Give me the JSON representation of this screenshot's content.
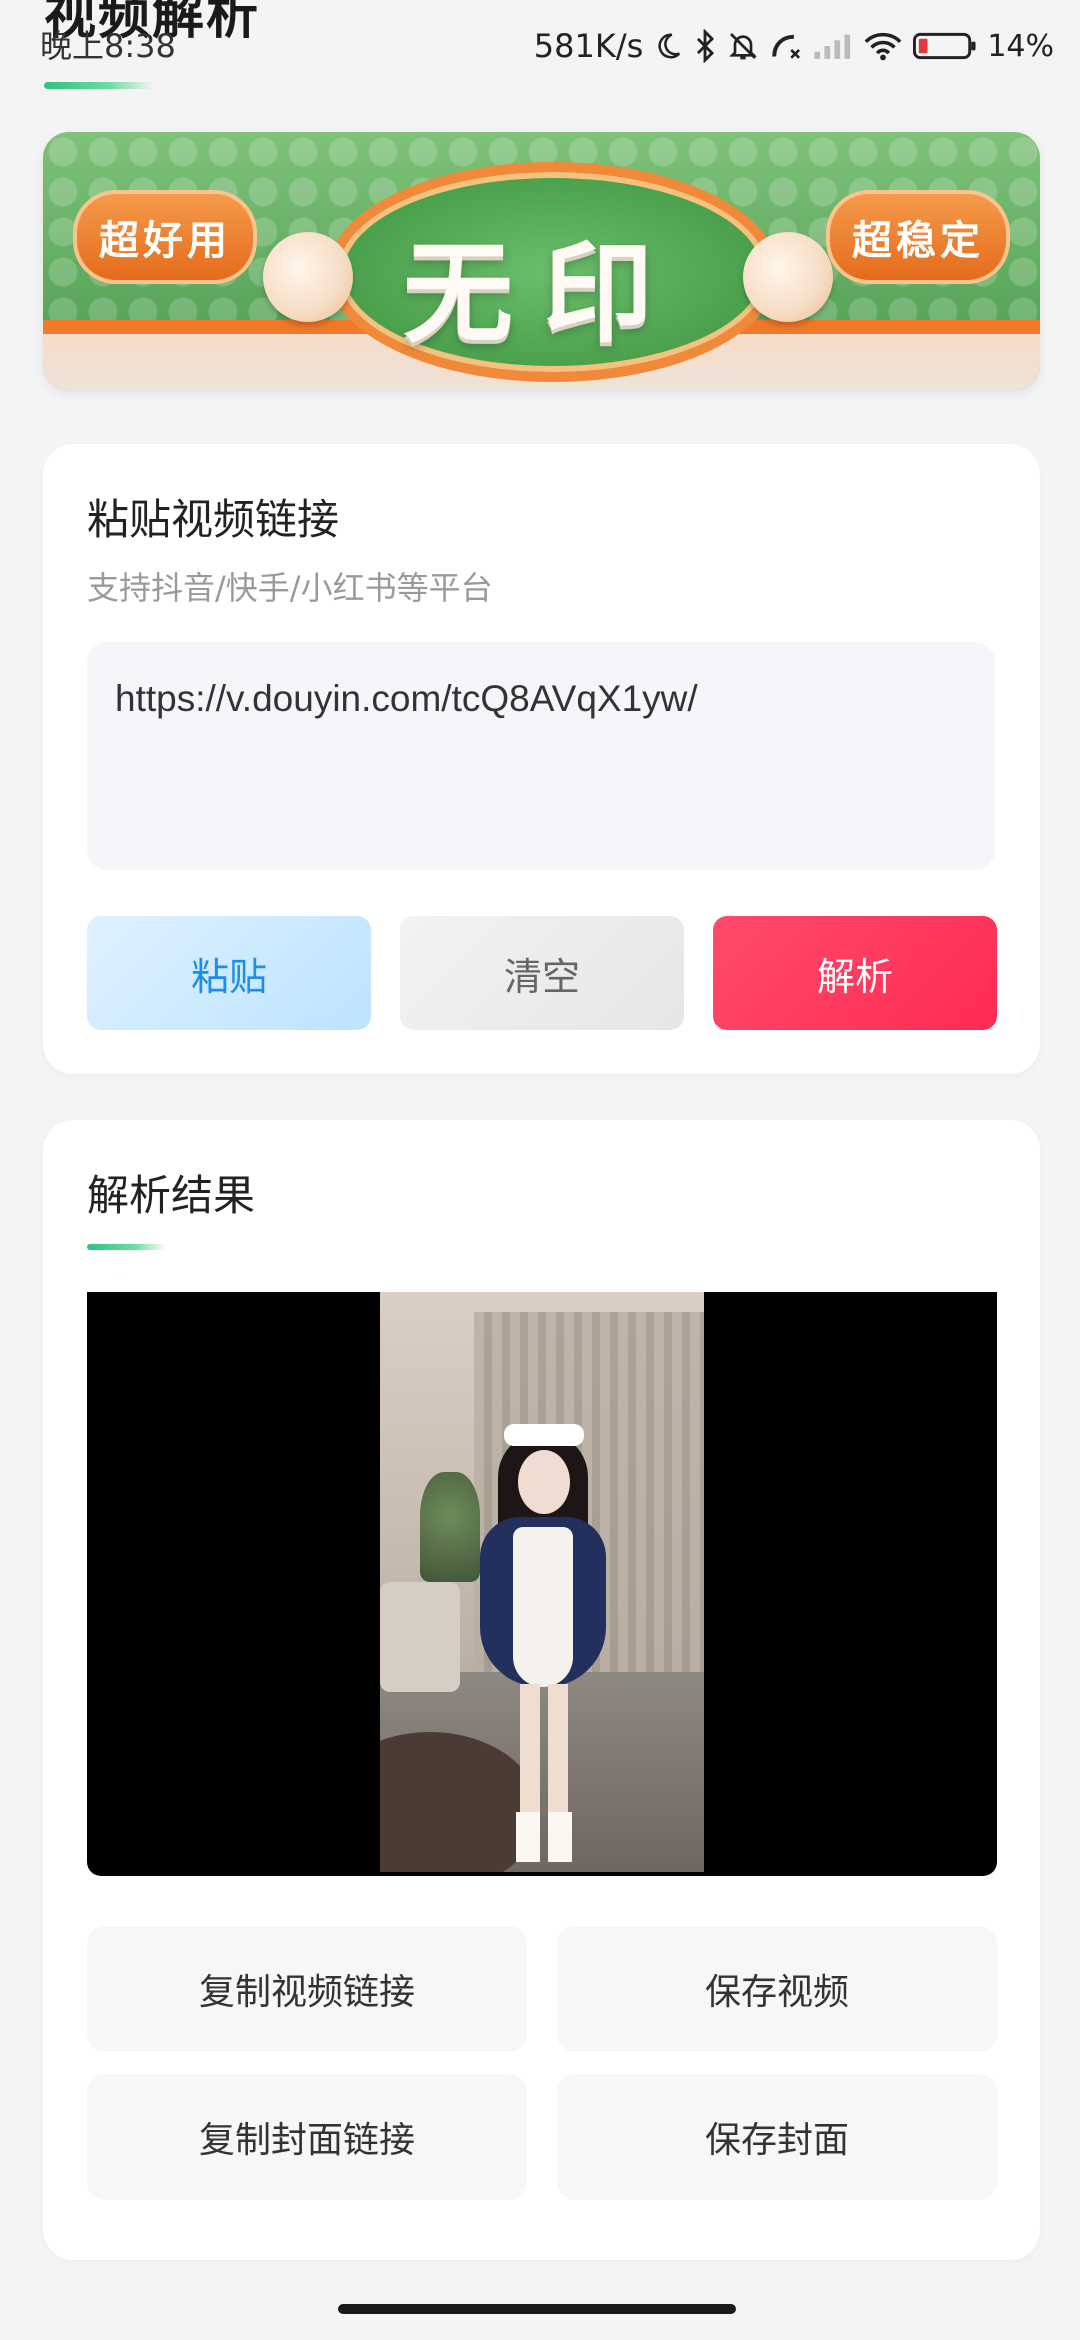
{
  "status_bar": {
    "time": "晚上8:38",
    "network_speed": "581K/s",
    "battery": "14%",
    "icons": [
      "moon-icon",
      "bluetooth-icon",
      "mute-bell-icon",
      "call-blocked-icon",
      "signal-icon",
      "wifi-icon",
      "battery-icon"
    ]
  },
  "page": {
    "title": "视频解析",
    "accent_color": "#2ec27e"
  },
  "banner": {
    "left_tag": "超好用",
    "center_text": "无印",
    "right_tag": "超稳定"
  },
  "input_card": {
    "title": "粘贴视频链接",
    "subtitle": "支持抖音/快手/小红书等平台",
    "url_value": "https://v.douyin.com/tcQ8AVqX1yw/",
    "buttons": {
      "paste": "粘贴",
      "clear": "清空",
      "parse": "解析"
    },
    "parse_color": "#ff2a55",
    "paste_color": "#1d8ee8"
  },
  "result_card": {
    "title": "解析结果",
    "actions": {
      "copy_video_link": "复制视频链接",
      "save_video": "保存视频",
      "copy_cover_link": "复制封面链接",
      "save_cover": "保存封面"
    }
  }
}
